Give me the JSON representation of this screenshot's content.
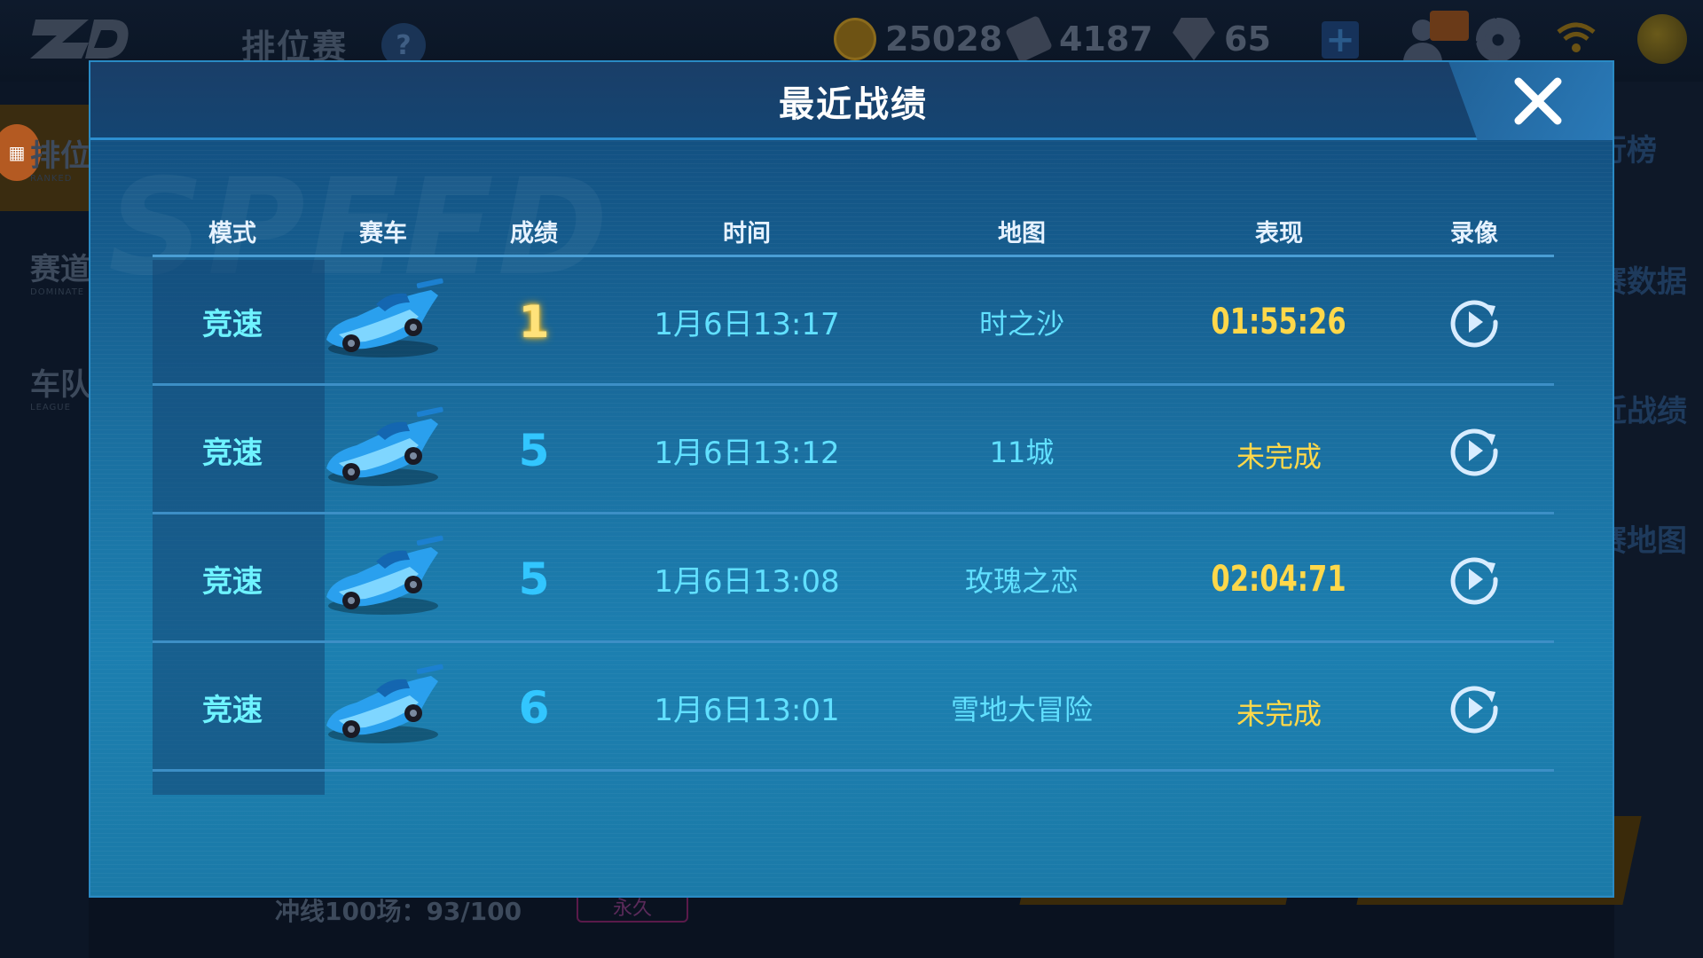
{
  "background": {
    "page_title": "排位赛",
    "help_label": "?",
    "resources": [
      {
        "icon": "coin-icon",
        "value": "25028"
      },
      {
        "icon": "ticket-icon",
        "value": "4187"
      },
      {
        "icon": "gem-icon",
        "value": "65"
      }
    ],
    "sidebar": [
      {
        "label": "排位",
        "sub": "RANKED"
      },
      {
        "label": "赛道",
        "sub": "DOMINATE"
      },
      {
        "label": "车队",
        "sub": "LEAGUE"
      }
    ],
    "right_labels": [
      "行榜",
      "赛数据",
      "近战绩",
      "赛地图"
    ],
    "bottom_text": "冲线100场：93/100",
    "bottom_tag": "永久"
  },
  "modal": {
    "title": "最近战绩",
    "headers": {
      "mode": "模式",
      "car": "赛车",
      "rank": "成绩",
      "time": "时间",
      "map": "地图",
      "performance": "表现",
      "replay": "录像"
    },
    "rows": [
      {
        "mode": "竞速",
        "rank": "1",
        "time": "1月6日13:17",
        "map": "时之沙",
        "performance": "01:55:26"
      },
      {
        "mode": "竞速",
        "rank": "5",
        "time": "1月6日13:12",
        "map": "11城",
        "performance": "未完成"
      },
      {
        "mode": "竞速",
        "rank": "5",
        "time": "1月6日13:08",
        "map": "玫瑰之恋",
        "performance": "02:04:71"
      },
      {
        "mode": "竞速",
        "rank": "6",
        "time": "1月6日13:01",
        "map": "雪地大冒险",
        "performance": "未完成"
      }
    ]
  },
  "colors": {
    "modal_top": "#11497a",
    "modal_bottom": "#1b7aa8",
    "mode_text": "#6ef3ff",
    "rank_text": "#32c6ff",
    "first_rank": "#ffe27a",
    "performance": "#ffd84a"
  }
}
